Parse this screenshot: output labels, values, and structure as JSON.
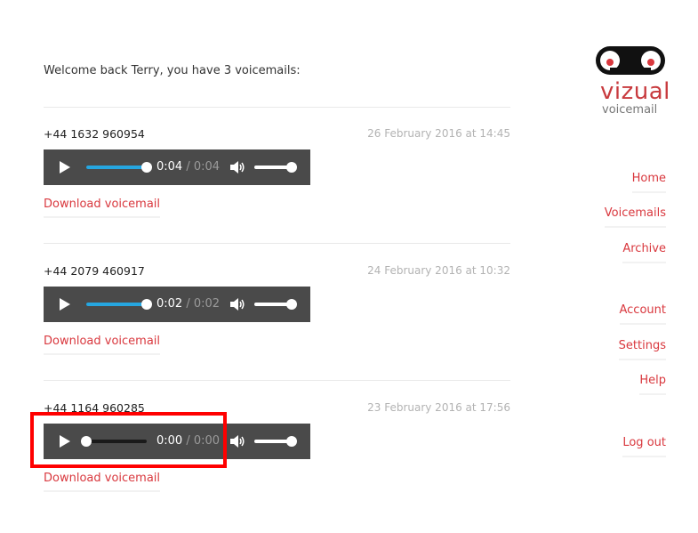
{
  "welcome_text": "Welcome back Terry, you have 3 voicemails:",
  "voicemails": [
    {
      "number": "+44 1632 960954",
      "date": "26 February 2016 at 14:45",
      "current_time": "0:04",
      "duration": "/ 0:04",
      "progress": 1.0,
      "download_label": "Download voicemail"
    },
    {
      "number": "+44 2079 460917",
      "date": "24 February 2016 at 10:32",
      "current_time": "0:02",
      "duration": "/ 0:02",
      "progress": 1.0,
      "download_label": "Download voicemail"
    },
    {
      "number": "+44 1164 960285",
      "date": "23 February 2016 at 17:56",
      "current_time": "0:00",
      "duration": "/ 0:00",
      "progress": 0.0,
      "download_label": "Download voicemail"
    }
  ],
  "volume_level": 1.0,
  "logo": {
    "brand": "vizual",
    "sub": "voicemail"
  },
  "nav": {
    "home": "Home",
    "voicemails": "Voicemails",
    "archive": "Archive",
    "account": "Account",
    "settings": "Settings",
    "help": "Help",
    "logout": "Log out"
  },
  "colors": {
    "accent": "#d9383e",
    "progress": "#26a6e0",
    "player_bg": "#4a4a4a",
    "highlight": "#ff0000"
  }
}
